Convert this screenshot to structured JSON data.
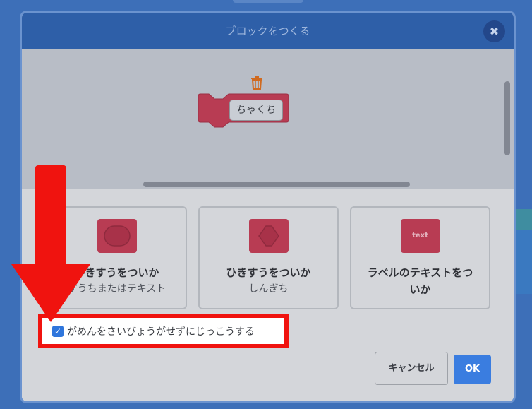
{
  "dialog": {
    "title": "ブロックをつくる",
    "close_icon": "close-icon"
  },
  "workspace": {
    "block_label": "ちゃくち",
    "trash_icon": "trash-icon"
  },
  "options": [
    {
      "title": "ひきすうをついか",
      "subtitle": "すうちまたはテキスト",
      "icon": "round-slot-icon"
    },
    {
      "title": "ひきすうをついか",
      "subtitle": "しんぎち",
      "icon": "hexagon-slot-icon"
    },
    {
      "title": "ラベルのテキストをつ\nいか",
      "icon_text": "text"
    }
  ],
  "checkbox": {
    "label": "がめんをさいびょうがせずにじっこうする",
    "checked": true
  },
  "buttons": {
    "cancel": "キャンセル",
    "ok": "OK"
  },
  "colors": {
    "block": "#b83c53",
    "header": "#2e5fa8",
    "ok": "#3a7de0",
    "highlight": "#f0130f"
  }
}
